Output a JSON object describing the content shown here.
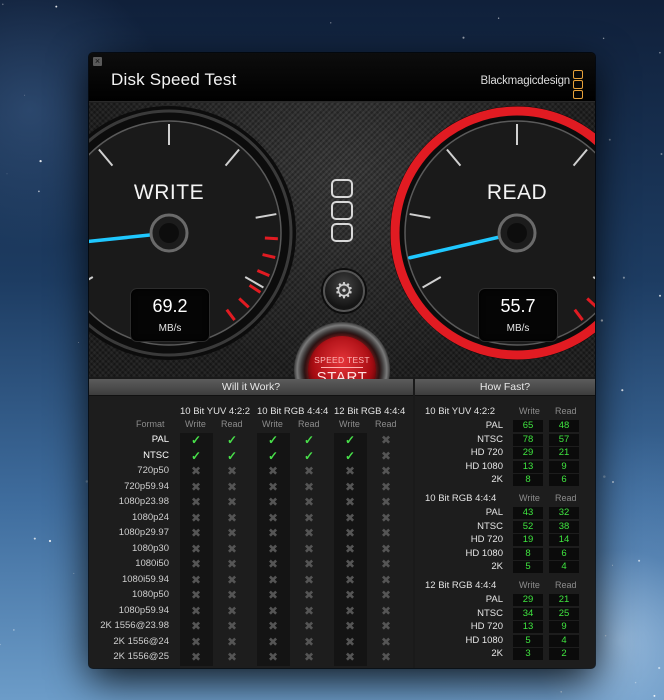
{
  "window": {
    "title": "Disk Speed Test",
    "brand": "Blackmagicdesign",
    "close_glyph": "×"
  },
  "gauges": {
    "write": {
      "label": "WRITE",
      "value": "69.2",
      "unit": "MB/s"
    },
    "read": {
      "label": "READ",
      "value": "55.7",
      "unit": "MB/s"
    }
  },
  "controls": {
    "settings_icon": "gear-icon",
    "start_top": "SPEED TEST",
    "start_label": "START"
  },
  "will_it_work": {
    "title": "Will it Work?",
    "format_header": "Format",
    "groups": [
      "10 Bit YUV 4:2:2",
      "10 Bit RGB 4:4:4",
      "12 Bit RGB 4:4:4"
    ],
    "sub_headers": [
      "Write",
      "Read"
    ],
    "rows": [
      {
        "format": "PAL",
        "checks": [
          true,
          true,
          true,
          true,
          true,
          false
        ]
      },
      {
        "format": "NTSC",
        "checks": [
          true,
          true,
          true,
          true,
          true,
          false
        ]
      },
      {
        "format": "720p50",
        "checks": [
          false,
          false,
          false,
          false,
          false,
          false
        ]
      },
      {
        "format": "720p59.94",
        "checks": [
          false,
          false,
          false,
          false,
          false,
          false
        ]
      },
      {
        "format": "1080p23.98",
        "checks": [
          false,
          false,
          false,
          false,
          false,
          false
        ]
      },
      {
        "format": "1080p24",
        "checks": [
          false,
          false,
          false,
          false,
          false,
          false
        ]
      },
      {
        "format": "1080p29.97",
        "checks": [
          false,
          false,
          false,
          false,
          false,
          false
        ]
      },
      {
        "format": "1080p30",
        "checks": [
          false,
          false,
          false,
          false,
          false,
          false
        ]
      },
      {
        "format": "1080i50",
        "checks": [
          false,
          false,
          false,
          false,
          false,
          false
        ]
      },
      {
        "format": "1080i59.94",
        "checks": [
          false,
          false,
          false,
          false,
          false,
          false
        ]
      },
      {
        "format": "1080p50",
        "checks": [
          false,
          false,
          false,
          false,
          false,
          false
        ]
      },
      {
        "format": "1080p59.94",
        "checks": [
          false,
          false,
          false,
          false,
          false,
          false
        ]
      },
      {
        "format": "2K 1556@23.98",
        "checks": [
          false,
          false,
          false,
          false,
          false,
          false
        ]
      },
      {
        "format": "2K 1556@24",
        "checks": [
          false,
          false,
          false,
          false,
          false,
          false
        ]
      },
      {
        "format": "2K 1556@25",
        "checks": [
          false,
          false,
          false,
          false,
          false,
          false
        ]
      }
    ],
    "check_glyph": "✓",
    "cross_glyph": "✖"
  },
  "how_fast": {
    "title": "How Fast?",
    "col_headers": [
      "Write",
      "Read"
    ],
    "groups": [
      {
        "name": "10 Bit YUV 4:2:2",
        "rows": [
          {
            "label": "PAL",
            "write": "65",
            "read": "48"
          },
          {
            "label": "NTSC",
            "write": "78",
            "read": "57"
          },
          {
            "label": "HD 720",
            "write": "29",
            "read": "21"
          },
          {
            "label": "HD 1080",
            "write": "13",
            "read": "9"
          },
          {
            "label": "2K",
            "write": "8",
            "read": "6"
          }
        ]
      },
      {
        "name": "10 Bit RGB 4:4:4",
        "rows": [
          {
            "label": "PAL",
            "write": "43",
            "read": "32"
          },
          {
            "label": "NTSC",
            "write": "52",
            "read": "38"
          },
          {
            "label": "HD 720",
            "write": "19",
            "read": "14"
          },
          {
            "label": "HD 1080",
            "write": "8",
            "read": "6"
          },
          {
            "label": "2K",
            "write": "5",
            "read": "4"
          }
        ]
      },
      {
        "name": "12 Bit RGB 4:4:4",
        "rows": [
          {
            "label": "PAL",
            "write": "29",
            "read": "21"
          },
          {
            "label": "NTSC",
            "write": "34",
            "read": "25"
          },
          {
            "label": "HD 720",
            "write": "13",
            "read": "9"
          },
          {
            "label": "HD 1080",
            "write": "5",
            "read": "4"
          },
          {
            "label": "2K",
            "write": "3",
            "read": "2"
          }
        ]
      }
    ]
  },
  "colors": {
    "needle": "#1fc8ff",
    "redline": "#e11b22",
    "check": "#48e04a",
    "speed_value": "#3fe43f",
    "brand_logo": "#e7a13a"
  }
}
